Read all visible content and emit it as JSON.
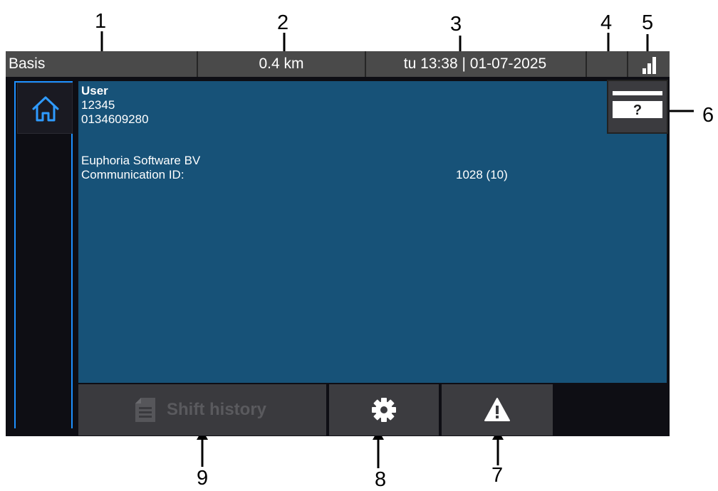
{
  "callouts": [
    "1",
    "2",
    "3",
    "4",
    "5",
    "6",
    "7",
    "8",
    "9"
  ],
  "status_bar": {
    "mode": "Basis",
    "distance": "0.4 km",
    "datetime": "tu 13:38 | 01-07-2025",
    "signal_icon": "signal-bars-icon"
  },
  "nav": {
    "home_icon": "home-icon"
  },
  "main": {
    "user_label": "User",
    "user_id": "12345",
    "phone": "0134609280",
    "company": "Euphoria Software BV",
    "comm_id_label": "Communication ID:",
    "comm_id_value": "1028 (10)"
  },
  "help_button": {
    "icon": "card-help-icon",
    "glyph": "?"
  },
  "bottom": {
    "shift_history_label": "Shift history",
    "shift_icon": "document-icon",
    "settings_icon": "gear-icon",
    "warning_icon": "warning-icon"
  },
  "colors": {
    "accent": "#1e90ff",
    "panel": "#175278",
    "status_bar": "#4a4a4a",
    "background": "#0e0e14"
  }
}
